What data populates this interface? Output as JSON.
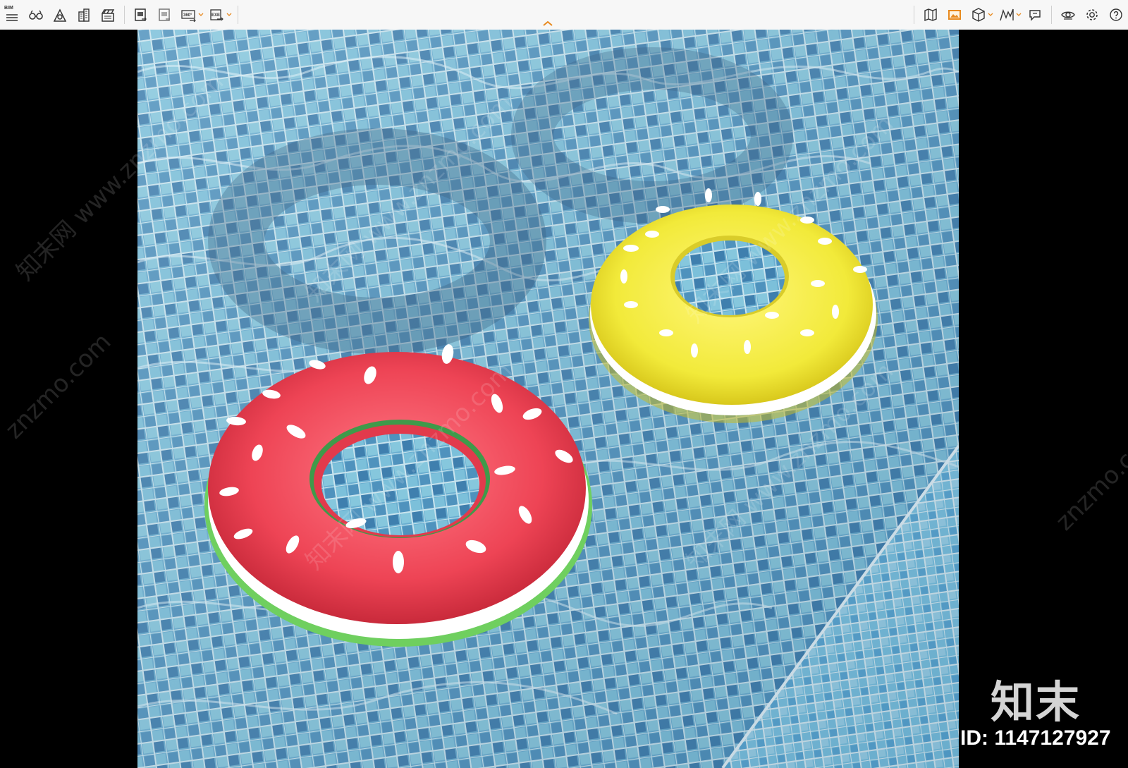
{
  "toolbar": {
    "bim_label": "BIM",
    "left_tools": [
      {
        "name": "bim-menu-icon"
      },
      {
        "name": "view-glasses-icon"
      },
      {
        "name": "house-model-icon"
      },
      {
        "name": "building-icon"
      },
      {
        "name": "clapperboard-icon"
      },
      {
        "name": "render-export-icon"
      },
      {
        "name": "sheet-export-icon"
      },
      {
        "name": "panorama-360-icon",
        "label": "360°"
      },
      {
        "name": "exe-export-icon",
        "label": "EXE"
      }
    ],
    "right_tools": [
      {
        "name": "map-book-icon"
      },
      {
        "name": "image-gallery-icon"
      },
      {
        "name": "cube-view-icon"
      },
      {
        "name": "mountains-icon"
      },
      {
        "name": "chat-cube-icon"
      },
      {
        "name": "eye-visibility-icon"
      },
      {
        "name": "settings-gear-icon"
      },
      {
        "name": "help-icon"
      }
    ]
  },
  "viewport": {
    "scene": "pool-with-watermelon-and-lemon-floats",
    "watermark_text": "知末网 www.znzmo.com",
    "watermark_text_short": "znzmo.com",
    "brand_logo": "知末",
    "brand_id": "ID: 1147127927"
  },
  "colors": {
    "toolbar_bg": "#f7f7f7",
    "accent_orange": "#e8891e",
    "pool_tile": "#5b9cc0",
    "watermelon_red": "#ee4455",
    "watermelon_green": "#69c45c",
    "lemon_yellow": "#f2ea3a"
  }
}
